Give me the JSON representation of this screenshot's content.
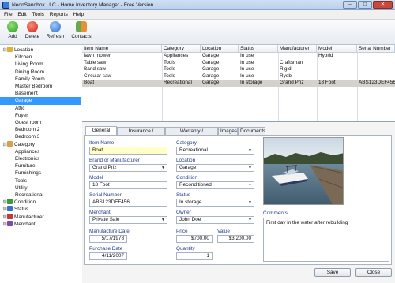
{
  "window": {
    "title": "NeonSandbox LLC - Home Inventory Manager - Free Version",
    "min": "–",
    "max": "□",
    "close": "✕"
  },
  "menu": [
    "File",
    "Edit",
    "Tools",
    "Reports",
    "Help"
  ],
  "toolbar": {
    "add": "Add",
    "delete": "Delete",
    "refresh": "Refresh",
    "contacts": "Contacts"
  },
  "sidebar": [
    {
      "label": "Location",
      "kind": "group",
      "expander": "⊟",
      "icon_color": "#e0b030"
    },
    {
      "label": "Kitchen"
    },
    {
      "label": "Living Room"
    },
    {
      "label": "Dining Room"
    },
    {
      "label": "Family Room"
    },
    {
      "label": "Master Bedroom"
    },
    {
      "label": "Basement"
    },
    {
      "label": "Garage",
      "selected": true
    },
    {
      "label": "Attic"
    },
    {
      "label": "Foyer"
    },
    {
      "label": "Guest room"
    },
    {
      "label": "Bedroom 2"
    },
    {
      "label": "Bedroom 3"
    },
    {
      "label": "Category",
      "kind": "group",
      "expander": "⊟",
      "icon_color": "#d6a24a"
    },
    {
      "label": "Appliances"
    },
    {
      "label": "Electronics"
    },
    {
      "label": "Furniture"
    },
    {
      "label": "Furnishings"
    },
    {
      "label": "Tools"
    },
    {
      "label": "Utility"
    },
    {
      "label": "Recreational"
    },
    {
      "label": "Condition",
      "kind": "group",
      "expander": "⊞",
      "icon_color": "#3c9b3c"
    },
    {
      "label": "Status",
      "kind": "group",
      "expander": "⊞",
      "icon_color": "#3670c8"
    },
    {
      "label": "Manufacturer",
      "kind": "group",
      "expander": "⊞",
      "icon_color": "#c03c3c"
    },
    {
      "label": "Merchant",
      "kind": "group",
      "expander": "⊞",
      "icon_color": "#7a4ab0"
    }
  ],
  "grid": {
    "columns": [
      "Item Name",
      "Category",
      "Location",
      "Status",
      "Manufacturer",
      "Model",
      "Serial Number"
    ],
    "rows": [
      [
        "lawn mower",
        "Appliances",
        "Garage",
        "In use",
        "",
        "Hybrid",
        ""
      ],
      [
        "Table saw",
        "Tools",
        "Garage",
        "In use",
        "Craftsman",
        "",
        ""
      ],
      [
        "Band saw",
        "Tools",
        "Garage",
        "In use",
        "Rigid",
        "",
        ""
      ],
      [
        "Circular saw",
        "Tools",
        "Garage",
        "In use",
        "Ryobi",
        "",
        ""
      ],
      [
        "Boat",
        "Recreational",
        "Garage",
        "In storage",
        "Grand Priz",
        "18 Foot",
        "ABS123DEF456"
      ]
    ],
    "selected_row": 4
  },
  "tabs": [
    "General Info",
    "Insurance / Appraisal",
    "Warranty / Maintenance",
    "Images",
    "Documents"
  ],
  "form": {
    "item_name": {
      "label": "Item Name",
      "value": "Boat"
    },
    "brand": {
      "label": "Brand or Manufacturer",
      "value": "Grand Priz"
    },
    "model": {
      "label": "Model",
      "value": "18 Foot"
    },
    "serial": {
      "label": "Serial Number",
      "value": "ABS123DEF456"
    },
    "merchant": {
      "label": "Merchant",
      "value": "Private Sale"
    },
    "mfg_date": {
      "label": "Manufacture Date",
      "value": "5/17/1978"
    },
    "purchase_date": {
      "label": "Purchase Date",
      "value": "4/11/2007"
    },
    "category": {
      "label": "Category",
      "value": "Recreational"
    },
    "location": {
      "label": "Location",
      "value": "Garage"
    },
    "condition": {
      "label": "Condition",
      "value": "Reconditioned"
    },
    "status": {
      "label": "Status",
      "value": "In storage"
    },
    "owner": {
      "label": "Owner",
      "value": "John Doe"
    },
    "price": {
      "label": "Price",
      "value": "$700.00"
    },
    "value": {
      "label": "Value",
      "value": "$3,200.00"
    },
    "quantity": {
      "label": "Quantity",
      "value": "1"
    },
    "comments": {
      "label": "Comments",
      "value": "First day in the water after rebuilding"
    }
  },
  "buttons": {
    "save": "Save",
    "close": "Close"
  },
  "colors": {
    "selection": "#3399ff",
    "label_blue": "#1f3a8a",
    "highlight_field": "#ffffc8"
  }
}
